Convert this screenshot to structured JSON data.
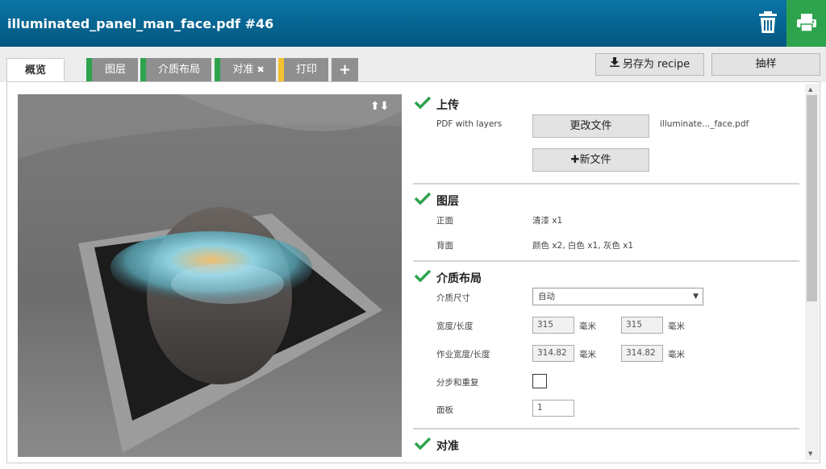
{
  "header": {
    "title": "illuminated_panel_man_face.pdf #46",
    "trash_icon": "trash-icon",
    "print_icon": "printer-icon"
  },
  "tabs": [
    {
      "label": "概览",
      "active": true
    },
    {
      "label": "图层",
      "stripe": "#2ea34e"
    },
    {
      "label": "介质布局",
      "stripe": "#2ea34e"
    },
    {
      "label": "对准",
      "stripe": "#2ea34e",
      "close": "✖"
    },
    {
      "label": "打印",
      "stripe": "#f2c230"
    },
    {
      "label": "+"
    }
  ],
  "toolbar": {
    "save_recipe": "另存为 recipe",
    "sample": "抽样"
  },
  "preview": {
    "arrows": "⬆⬇"
  },
  "upload": {
    "title": "上传",
    "type_label": "PDF with layers",
    "change_file": "更改文件",
    "filename": "illuminate..._face.pdf",
    "new_file": "新文件"
  },
  "layers": {
    "title": "图层",
    "front_label": "正面",
    "front_value": "清漆 x1",
    "back_label": "背面",
    "back_value": "颜色 x2, 白色 x1, 灰色 x1"
  },
  "media": {
    "title": "介质布局",
    "size_label": "介质尺寸",
    "size_value": "自动",
    "wl_label": "宽度/长度",
    "width": "315",
    "length": "315",
    "unit": "毫米",
    "job_label": "作业宽度/长度",
    "job_width": "314.82",
    "job_length": "314.82",
    "step_label": "分步和重复",
    "panel_label": "面板",
    "panel_value": "1"
  },
  "align": {
    "title": "对准"
  }
}
